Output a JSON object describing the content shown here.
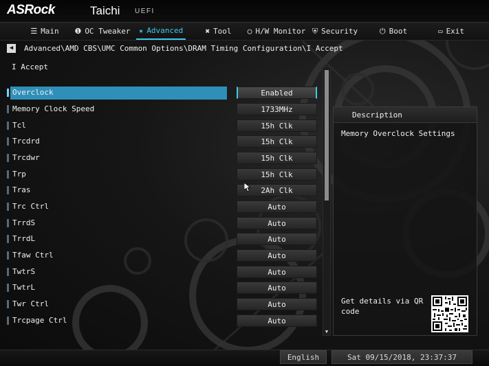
{
  "header": {
    "brand": "ASRock",
    "model": "Taichi",
    "firmware": "UEFI"
  },
  "nav": {
    "items": [
      {
        "label": "Main",
        "icon": "list-icon",
        "active": false
      },
      {
        "label": "OC Tweaker",
        "icon": "rocket-icon",
        "active": false
      },
      {
        "label": "Advanced",
        "icon": "star-icon",
        "active": true
      },
      {
        "label": "Tool",
        "icon": "tools-icon",
        "active": false
      },
      {
        "label": "H/W Monitor",
        "icon": "monitor-icon",
        "active": false
      },
      {
        "label": "Security",
        "icon": "shield-icon",
        "active": false
      },
      {
        "label": "Boot",
        "icon": "power-icon",
        "active": false
      },
      {
        "label": "Exit",
        "icon": "exit-door-icon",
        "active": false
      }
    ],
    "active_color": "#3fc9e8"
  },
  "breadcrumb": {
    "path": "Advanced\\AMD CBS\\UMC Common Options\\DRAM Timing Configuration\\I Accept"
  },
  "page": {
    "title": "I Accept"
  },
  "settings": [
    {
      "label": "Overclock",
      "value": "Enabled",
      "selected": true
    },
    {
      "label": "Memory Clock Speed",
      "value": "1733MHz",
      "selected": false
    },
    {
      "label": "Tcl",
      "value": "15h Clk",
      "selected": false
    },
    {
      "label": "Trcdrd",
      "value": "15h Clk",
      "selected": false
    },
    {
      "label": "Trcdwr",
      "value": "15h Clk",
      "selected": false
    },
    {
      "label": "Trp",
      "value": "15h Clk",
      "selected": false
    },
    {
      "label": "Tras",
      "value": "2Ah Clk",
      "selected": false
    },
    {
      "label": "Trc Ctrl",
      "value": "Auto",
      "selected": false
    },
    {
      "label": "TrrdS",
      "value": "Auto",
      "selected": false
    },
    {
      "label": "TrrdL",
      "value": "Auto",
      "selected": false
    },
    {
      "label": "Tfaw Ctrl",
      "value": "Auto",
      "selected": false
    },
    {
      "label": "TwtrS",
      "value": "Auto",
      "selected": false
    },
    {
      "label": "TwtrL",
      "value": "Auto",
      "selected": false
    },
    {
      "label": "Twr Ctrl",
      "value": "Auto",
      "selected": false
    },
    {
      "label": "Trcpage Ctrl",
      "value": "Auto",
      "selected": false
    }
  ],
  "description": {
    "title": "Description",
    "text": "Memory Overclock Settings",
    "qr_text": "Get details via QR code"
  },
  "footer": {
    "language": "English",
    "datetime": "Sat 09/15/2018, 23:37:37"
  },
  "colors": {
    "accent": "#3fc9e8",
    "selected_row": "#2f8fb8"
  }
}
